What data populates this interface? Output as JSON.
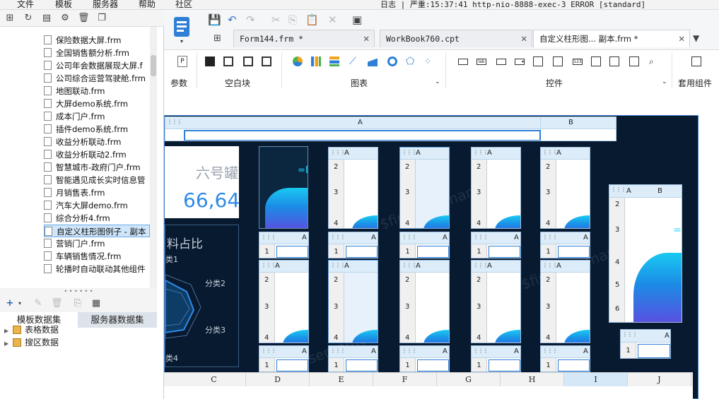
{
  "menu": {
    "file": "文件",
    "template": "模板",
    "server": "服务器",
    "help": "帮助",
    "community": "社区"
  },
  "status": {
    "log_label": "日志",
    "severity": "严重:15:37:41 http-nio-8888-exec-3 ERROR [standard]"
  },
  "tree": {
    "items": [
      "保险数据大屏.frm",
      "全国销售额分析.frm",
      "公司年会数据展现大屏.f",
      "公司综合运营驾驶舱.frm",
      "地图联动.frm",
      "大屏demo系统.frm",
      "成本门户.frm",
      "插件demo系统.frm",
      "收益分析联动.frm",
      "收益分析联动2.frm",
      "智慧城市-政府门户.frm",
      "智能遇见成长实时信息管",
      "月销售表.frm",
      "汽车大屏demo.frm",
      "综合分析4.frm",
      "自定义柱形图例子 - 副本",
      "营销门户.frm",
      "车辆销售情况.frm",
      "轮播时自动联动其他组件"
    ],
    "selected_index": 15
  },
  "datasets": {
    "tab_template": "模板数据集",
    "tab_server": "服务器数据集",
    "items": [
      "表格数据",
      "搜区数据"
    ]
  },
  "file_tabs": [
    {
      "label": "Form144.frm *",
      "active": false
    },
    {
      "label": "WorkBook760.cpt",
      "active": false
    },
    {
      "label": "自定义柱形图... 副本.frm *",
      "active": true
    }
  ],
  "ribbon": {
    "param_label": "参数",
    "param_icon_letter": "P",
    "blank_label": "空白块",
    "chart_label": "图表",
    "control_label": "控件",
    "kit_label": "套用组件"
  },
  "canvas": {
    "top_col_a": "A",
    "top_col_b": "B",
    "tile_title": "六号罐",
    "tile_value": "66,64",
    "tile_side": "=B",
    "radar_title": "料占比",
    "radar_cat1": "类1",
    "radar_cat2": "分类2",
    "radar_cat3": "分类3",
    "radar_cat4": "类4",
    "right_eq": "=",
    "col_a": "A",
    "col_b": "B",
    "rows": [
      "1",
      "2",
      "3",
      "4",
      "5",
      "6"
    ],
    "bottom_cols": [
      "C",
      "D",
      "E",
      "F",
      "G",
      "H",
      "I",
      "J"
    ]
  },
  "colors": {
    "accent": "#3d7fd0",
    "dash_bg": "#071a30",
    "selection": "#cfe6fb"
  }
}
